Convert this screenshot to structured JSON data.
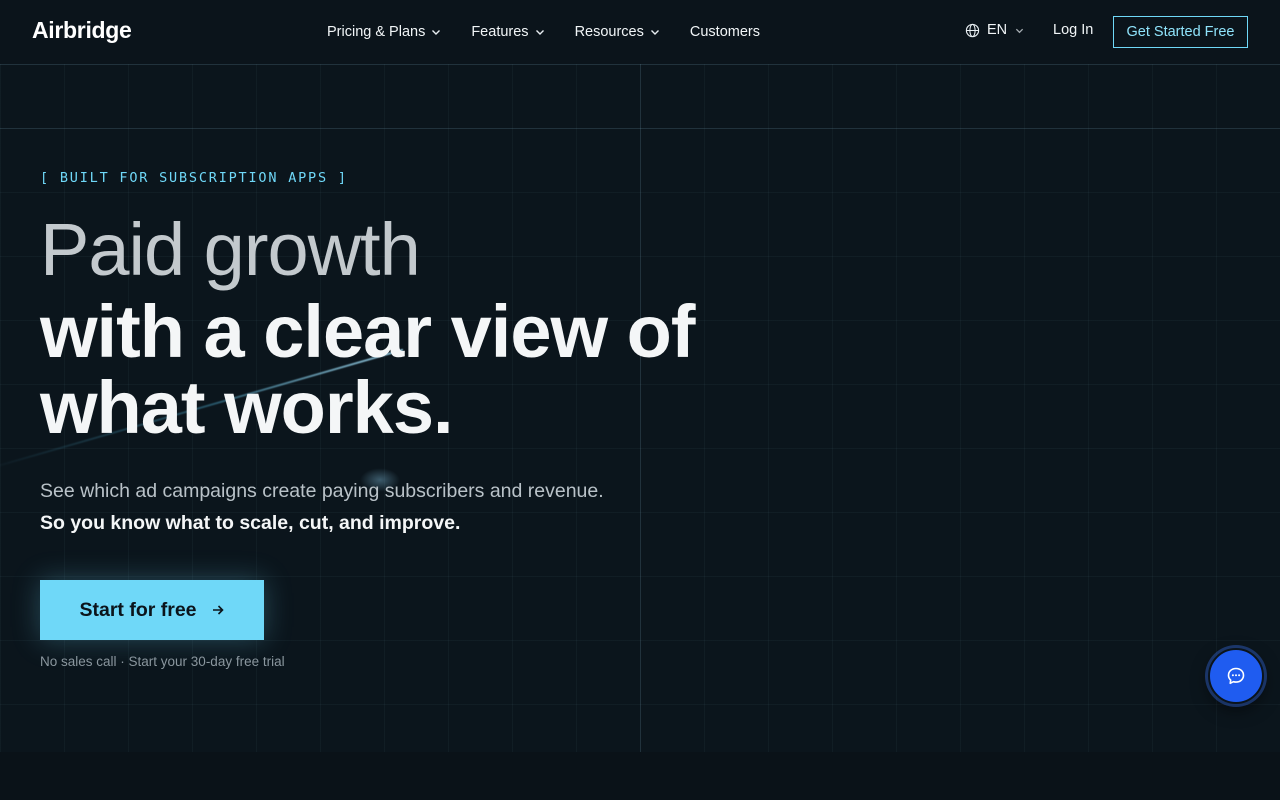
{
  "header": {
    "logo": "Airbridge",
    "nav": [
      {
        "label": "Pricing & Plans",
        "has_dropdown": true
      },
      {
        "label": "Features",
        "has_dropdown": true
      },
      {
        "label": "Resources",
        "has_dropdown": true
      },
      {
        "label": "Customers",
        "has_dropdown": false
      }
    ],
    "language": "EN",
    "login_label": "Log In",
    "cta_label": "Get Started Free"
  },
  "hero": {
    "eyebrow": "[ BUILT FOR SUBSCRIPTION APPS ]",
    "headline_light": "Paid growth",
    "headline_bold": "with a clear view of what works.",
    "subhead": "See which ad campaigns create paying subscribers and revenue.",
    "subhead_bold": "So you know what to scale, cut, and improve.",
    "button_label": "Start for free",
    "note": "No sales call · Start your 30-day free trial"
  },
  "icons": {
    "language": "globe-icon",
    "dropdown": "chevron-down-icon",
    "button": "arrow-right-icon",
    "chat": "chat-bubble-icon"
  },
  "colors": {
    "background": "#0b151c",
    "accent": "#6fd8f8",
    "chat_button": "#1f5cf0"
  }
}
